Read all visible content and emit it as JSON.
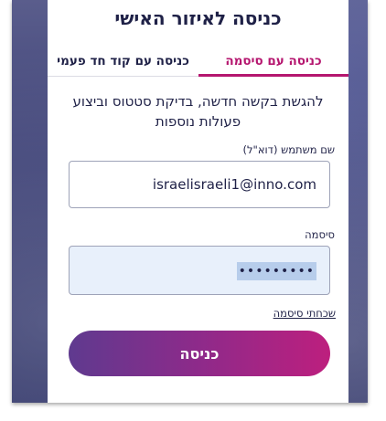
{
  "login": {
    "title": "כניסה לאיזור האישי",
    "tabs": {
      "password": "כניסה עם סיסמה",
      "otp": "כניסה עם קוד חד פעמי"
    },
    "intro": "להגשת בקשה חדשה, בדיקת סטטוס וביצוע פעולות נוספות",
    "username": {
      "label": "שם משתמש (דוא\"ל)",
      "value": "israelisraeli1@inno.com"
    },
    "password": {
      "label": "סיסמה",
      "masked_value": "•••••••••"
    },
    "forgot_link": "שכחתי סיסמה",
    "submit_label": "כניסה"
  },
  "colors": {
    "accent": "#b5166f",
    "text": "#1f2147",
    "button_gradient_start": "#5f3a8f",
    "button_gradient_end": "#bd1f7e"
  }
}
